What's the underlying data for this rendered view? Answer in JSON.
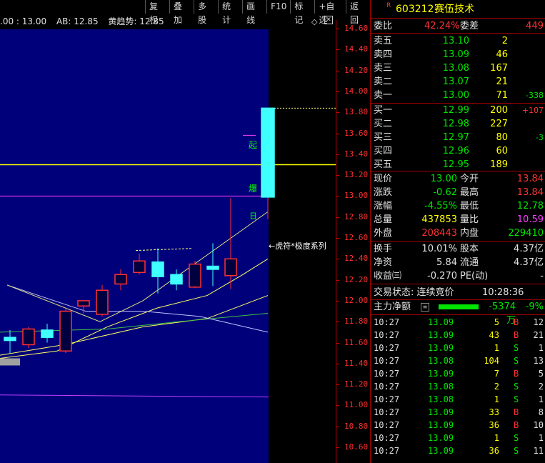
{
  "menu": [
    "复权",
    "叠加",
    "多股",
    "统计",
    "画线",
    "F10",
    "标记",
    "+自选",
    "返回"
  ],
  "indicator": {
    "prefix": ".00 : 13.00",
    "ab": "AB: 12.85",
    "trend": "黄趋势: 12.85"
  },
  "chart_labels": {
    "qi": "起",
    "bao": "爆",
    "ri": "日",
    "series_note": "←虎符*极度系列"
  },
  "yaxis": [
    "14.60",
    "14.40",
    "14.20",
    "14.00",
    "13.80",
    "13.60",
    "13.40",
    "13.20",
    "13.00",
    "12.80",
    "12.60",
    "12.40",
    "12.20",
    "12.00",
    "11.80",
    "11.60",
    "11.40",
    "11.20",
    "11.00",
    "10.80",
    "10.60"
  ],
  "stock": {
    "flag": "R",
    "code": "603212",
    "name": "赛伍技术"
  },
  "weibi": {
    "label1": "委比",
    "value1": "42.24%",
    "label2": "委差",
    "value2": "449"
  },
  "sells": [
    {
      "label": "卖五",
      "price": "13.10",
      "vol": "2",
      "chg": ""
    },
    {
      "label": "卖四",
      "price": "13.09",
      "vol": "46",
      "chg": ""
    },
    {
      "label": "卖三",
      "price": "13.08",
      "vol": "167",
      "chg": ""
    },
    {
      "label": "卖二",
      "price": "13.07",
      "vol": "21",
      "chg": ""
    },
    {
      "label": "卖一",
      "price": "13.00",
      "vol": "71",
      "chg": "-338"
    }
  ],
  "buys": [
    {
      "label": "买一",
      "price": "12.99",
      "vol": "200",
      "chg": "+107"
    },
    {
      "label": "买二",
      "price": "12.98",
      "vol": "227",
      "chg": ""
    },
    {
      "label": "买三",
      "price": "12.97",
      "vol": "80",
      "chg": "-3"
    },
    {
      "label": "买四",
      "price": "12.96",
      "vol": "60",
      "chg": ""
    },
    {
      "label": "买五",
      "price": "12.95",
      "vol": "189",
      "chg": ""
    }
  ],
  "quote": [
    {
      "l1": "现价",
      "v1": "13.00",
      "c1": "green",
      "l2": "今开",
      "v2": "13.84",
      "c2": "red"
    },
    {
      "l1": "涨跌",
      "v1": "-0.62",
      "c1": "green",
      "l2": "最高",
      "v2": "13.84",
      "c2": "red"
    },
    {
      "l1": "涨幅",
      "v1": "-4.55%",
      "c1": "green",
      "l2": "最低",
      "v2": "12.78",
      "c2": "green"
    },
    {
      "l1": "总量",
      "v1": "437853",
      "c1": "yellow",
      "l2": "量比",
      "v2": "10.59",
      "c2": "mag"
    },
    {
      "l1": "外盘",
      "v1": "208443",
      "c1": "red",
      "l2": "内盘",
      "v2": "229410",
      "c2": "green"
    }
  ],
  "fund": [
    {
      "l1": "换手",
      "v1": "10.01%",
      "l2": "股本",
      "v2": "4.37亿"
    },
    {
      "l1": "净资",
      "v1": "5.84",
      "l2": "流通",
      "v2": "4.37亿"
    },
    {
      "l1": "收益㈢",
      "v1": "-0.270",
      "l2": "PE(动)",
      "v2": "-"
    }
  ],
  "status": {
    "label": "交易状态: 连续竞价",
    "time": "10:28:36"
  },
  "mainflow": {
    "label": "主力净额",
    "value": "-5374万",
    "pct": "-9%"
  },
  "ticks": [
    {
      "t": "10:27",
      "p": "13.09",
      "v": "5",
      "s": "B",
      "n": "12"
    },
    {
      "t": "10:27",
      "p": "13.09",
      "v": "43",
      "s": "B",
      "n": "21"
    },
    {
      "t": "10:27",
      "p": "13.09",
      "v": "1",
      "s": "S",
      "n": "1"
    },
    {
      "t": "10:27",
      "p": "13.08",
      "v": "104",
      "s": "S",
      "n": "13"
    },
    {
      "t": "10:27",
      "p": "13.09",
      "v": "7",
      "s": "B",
      "n": "5"
    },
    {
      "t": "10:27",
      "p": "13.08",
      "v": "2",
      "s": "S",
      "n": "2"
    },
    {
      "t": "10:27",
      "p": "13.08",
      "v": "1",
      "s": "S",
      "n": "1"
    },
    {
      "t": "10:27",
      "p": "13.09",
      "v": "33",
      "s": "B",
      "n": "8"
    },
    {
      "t": "10:27",
      "p": "13.09",
      "v": "36",
      "s": "B",
      "n": "10"
    },
    {
      "t": "10:27",
      "p": "13.09",
      "v": "1",
      "s": "S",
      "n": "1"
    },
    {
      "t": "10:27",
      "p": "13.09",
      "v": "36",
      "s": "S",
      "n": "11"
    }
  ],
  "chart_data": {
    "type": "candlestick",
    "candles": [
      {
        "o": 11.65,
        "h": 11.72,
        "l": 11.5,
        "c": 11.62
      },
      {
        "o": 11.58,
        "h": 11.75,
        "l": 11.55,
        "c": 11.73
      },
      {
        "o": 11.72,
        "h": 11.78,
        "l": 11.6,
        "c": 11.65
      },
      {
        "o": 11.52,
        "h": 11.92,
        "l": 11.5,
        "c": 11.9
      },
      {
        "o": 11.95,
        "h": 12.0,
        "l": 11.88,
        "c": 12.0
      },
      {
        "o": 11.87,
        "h": 12.15,
        "l": 11.85,
        "c": 12.1
      },
      {
        "o": 12.16,
        "h": 12.3,
        "l": 12.1,
        "c": 12.25
      },
      {
        "o": 12.27,
        "h": 12.45,
        "l": 12.25,
        "c": 12.38
      },
      {
        "o": 12.37,
        "h": 12.5,
        "l": 12.07,
        "c": 12.23
      },
      {
        "o": 12.25,
        "h": 12.3,
        "l": 12.1,
        "c": 12.16
      },
      {
        "o": 12.13,
        "h": 12.38,
        "l": 12.12,
        "c": 12.35
      },
      {
        "o": 12.33,
        "h": 12.55,
        "l": 12.14,
        "c": 12.3
      },
      {
        "o": 12.24,
        "h": 12.98,
        "l": 12.11,
        "c": 12.4
      },
      {
        "o": 12.99,
        "h": 13.84,
        "l": 12.78,
        "c": 13.84
      }
    ]
  }
}
